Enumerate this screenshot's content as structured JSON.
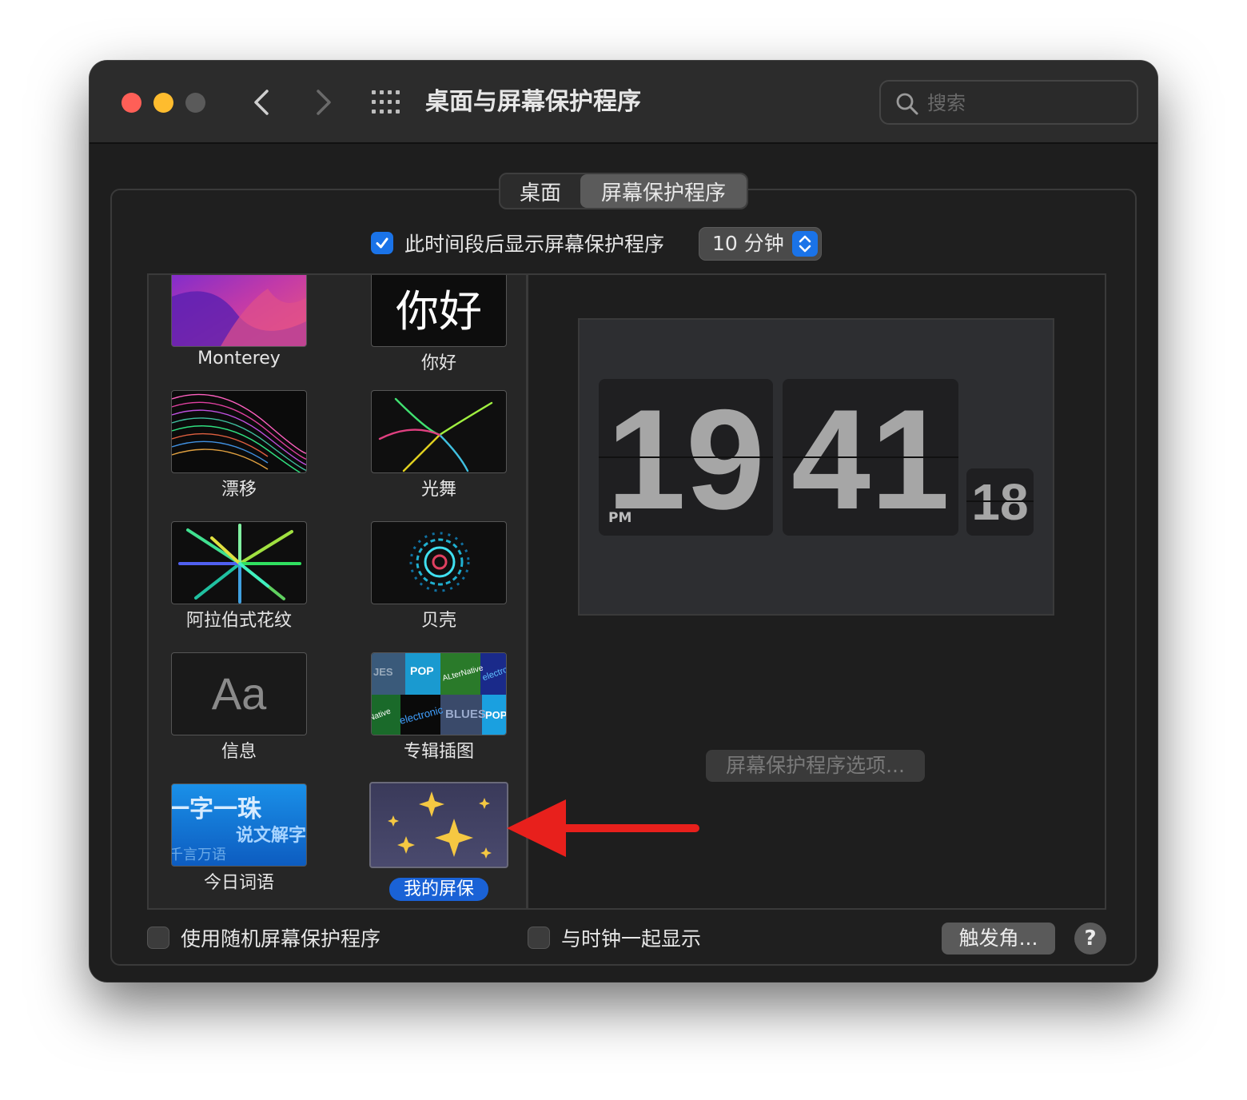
{
  "window": {
    "title": "桌面与屏幕保护程序"
  },
  "search": {
    "placeholder": "搜索"
  },
  "tabs": [
    {
      "label": "桌面",
      "active": false
    },
    {
      "label": "屏幕保护程序",
      "active": true
    }
  ],
  "show_after": {
    "label": "此时间段后显示屏幕保护程序",
    "checked": true,
    "value": "10 分钟"
  },
  "savers": [
    {
      "name": "Monterey",
      "selected": false
    },
    {
      "name": "你好",
      "selected": false,
      "thumb_text": "你好"
    },
    {
      "name": "漂移",
      "selected": false
    },
    {
      "name": "光舞",
      "selected": false
    },
    {
      "name": "阿拉伯式花纹",
      "selected": false
    },
    {
      "name": "贝壳",
      "selected": false
    },
    {
      "name": "信息",
      "selected": false,
      "thumb_text": "Aa"
    },
    {
      "name": "专辑插图",
      "selected": false,
      "thumb_words": [
        "POP",
        "ALterNative",
        "electro",
        "Native",
        "electronic",
        "BLUES",
        "POP",
        "JES"
      ]
    },
    {
      "name": "今日词语",
      "selected": false,
      "thumb_words": [
        "一字一珠",
        "说文解字",
        "千言万语"
      ]
    },
    {
      "name": "我的屏保",
      "selected": true
    }
  ],
  "preview": {
    "hour": "19",
    "minute": "41",
    "second": "18",
    "ampm": "PM",
    "options_button": "屏幕保护程序选项..."
  },
  "footer": {
    "random_label": "使用随机屏幕保护程序",
    "random_checked": false,
    "clock_label": "与时钟一起显示",
    "clock_checked": false,
    "hot_corners": "触发角...",
    "help": "?"
  },
  "colors": {
    "accent": "#1a73e8",
    "annotation_arrow": "#e8201c"
  },
  "icons": [
    "close-icon",
    "minimize-icon",
    "zoom-icon",
    "chevron-left-icon",
    "chevron-right-icon",
    "grid-icon",
    "search-icon",
    "checkmark-icon",
    "stepper-icon",
    "arrow-icon"
  ]
}
